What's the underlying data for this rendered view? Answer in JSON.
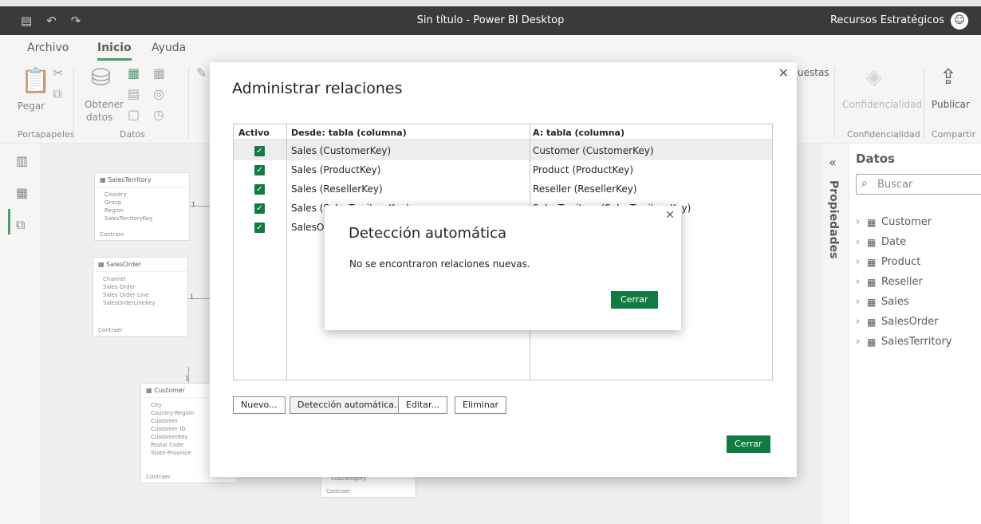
{
  "window": {
    "title": "Sin título - Power BI Desktop",
    "user": "Recursos Estratégicos"
  },
  "ribbon": {
    "tabs": [
      {
        "label": "Archivo"
      },
      {
        "label": "Inicio"
      },
      {
        "label": "Ayuda"
      }
    ],
    "groups": {
      "clipboard": {
        "label": "Portapapeles",
        "paste": "Pegar"
      },
      "data": {
        "label": "Datos",
        "get_data_1": "Obtener",
        "get_data_2": "datos"
      },
      "partial_label": "uestas",
      "sensitivity": {
        "label": "Confidencialidad",
        "button": "Confidencialidad"
      },
      "share": {
        "label": "Compartir",
        "button": "Publicar"
      }
    }
  },
  "model_cards": [
    {
      "title": "SalesTerritory",
      "fields": [
        "Country",
        "Group",
        "Region",
        "SalesTerritoryKey"
      ],
      "footer": "Contraer"
    },
    {
      "title": "SalesOrder",
      "fields": [
        "Channel",
        "Sales Order",
        "Sales Order Line",
        "SalesOrderLineKey"
      ],
      "footer": "Contraer"
    },
    {
      "title": "Customer",
      "fields": [
        "City",
        "Country-Region",
        "Customer",
        "Customer ID",
        "CustomerKey",
        "Postal Code",
        "State-Province"
      ],
      "footer": "Contraer"
    },
    {
      "title": "",
      "fields": [
        "Subcategory"
      ],
      "footer": "Contraer"
    }
  ],
  "cardinality": {
    "one": "1"
  },
  "properties_pane": {
    "label": "Propiedades"
  },
  "data_pane": {
    "title": "Datos",
    "search_placeholder": "Buscar",
    "tables": [
      "Customer",
      "Date",
      "Product",
      "Reseller",
      "Sales",
      "SalesOrder",
      "SalesTerritory"
    ]
  },
  "dialog": {
    "title": "Administrar relaciones",
    "columns": {
      "active": "Activo",
      "from": "Desde: tabla (columna)",
      "to": "A: tabla (columna)"
    },
    "rows": [
      {
        "from": "Sales (CustomerKey)",
        "to": "Customer (CustomerKey)"
      },
      {
        "from": "Sales (ProductKey)",
        "to": "Product (ProductKey)"
      },
      {
        "from": "Sales (ResellerKey)",
        "to": "Reseller (ResellerKey)"
      },
      {
        "from": "Sales (SalesTerritoryKey)",
        "to": "SalesTerritory (SalesTerritoryKey)"
      },
      {
        "from": "SalesOrder",
        "to": ""
      }
    ],
    "buttons": {
      "new": "Nuevo...",
      "autodetect": "Detección automática...",
      "edit": "Editar...",
      "delete": "Eliminar",
      "close": "Cerrar"
    }
  },
  "popup": {
    "title": "Detección automática",
    "message": "No se encontraron relaciones nuevas.",
    "close": "Cerrar"
  },
  "colors": {
    "accent": "#107c41",
    "titlebar": "#3b3a39"
  }
}
